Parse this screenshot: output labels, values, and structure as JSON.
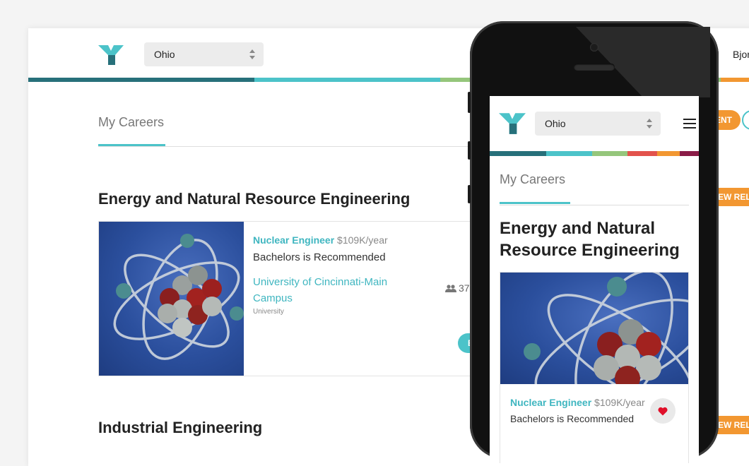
{
  "colors": {
    "teal": "#4cc3c9",
    "darkteal": "#27707a",
    "green": "#95c67b",
    "red": "#e2534c",
    "orange": "#f29731",
    "maroon": "#8a1c47"
  },
  "desktop": {
    "state_select": {
      "value": "Ohio"
    },
    "user_name": "Bjor",
    "tab_title": "My Careers",
    "sections": [
      {
        "title": "Energy and Natural Resource Engineering",
        "card": {
          "job_name": "Nuclear Engineer",
          "salary": "$109K/year",
          "education": "Bachelors is Recommended",
          "school_line1": "University of Cincinnati-Main",
          "school_line2": "Campus",
          "school_type": "University",
          "count": "37,",
          "explore_button": "E"
        }
      },
      {
        "title": "Industrial Engineering"
      }
    ],
    "orange_pill_1": "ENT",
    "orange_pill_2": "EW REL",
    "orange_pill_3": "EW REL"
  },
  "mobile": {
    "state_select": {
      "value": "Ohio"
    },
    "tab_title": "My Careers",
    "section_title_line1": "Energy and Natural",
    "section_title_line2": "Resource Engineering",
    "card": {
      "job_name": "Nuclear Engineer",
      "salary": "$109K/year",
      "education": "Bachelors is Recommended"
    }
  },
  "icons": [
    "logo-icon",
    "select-arrows-icon",
    "people-icon",
    "hamburger-menu-icon",
    "heart-icon"
  ]
}
